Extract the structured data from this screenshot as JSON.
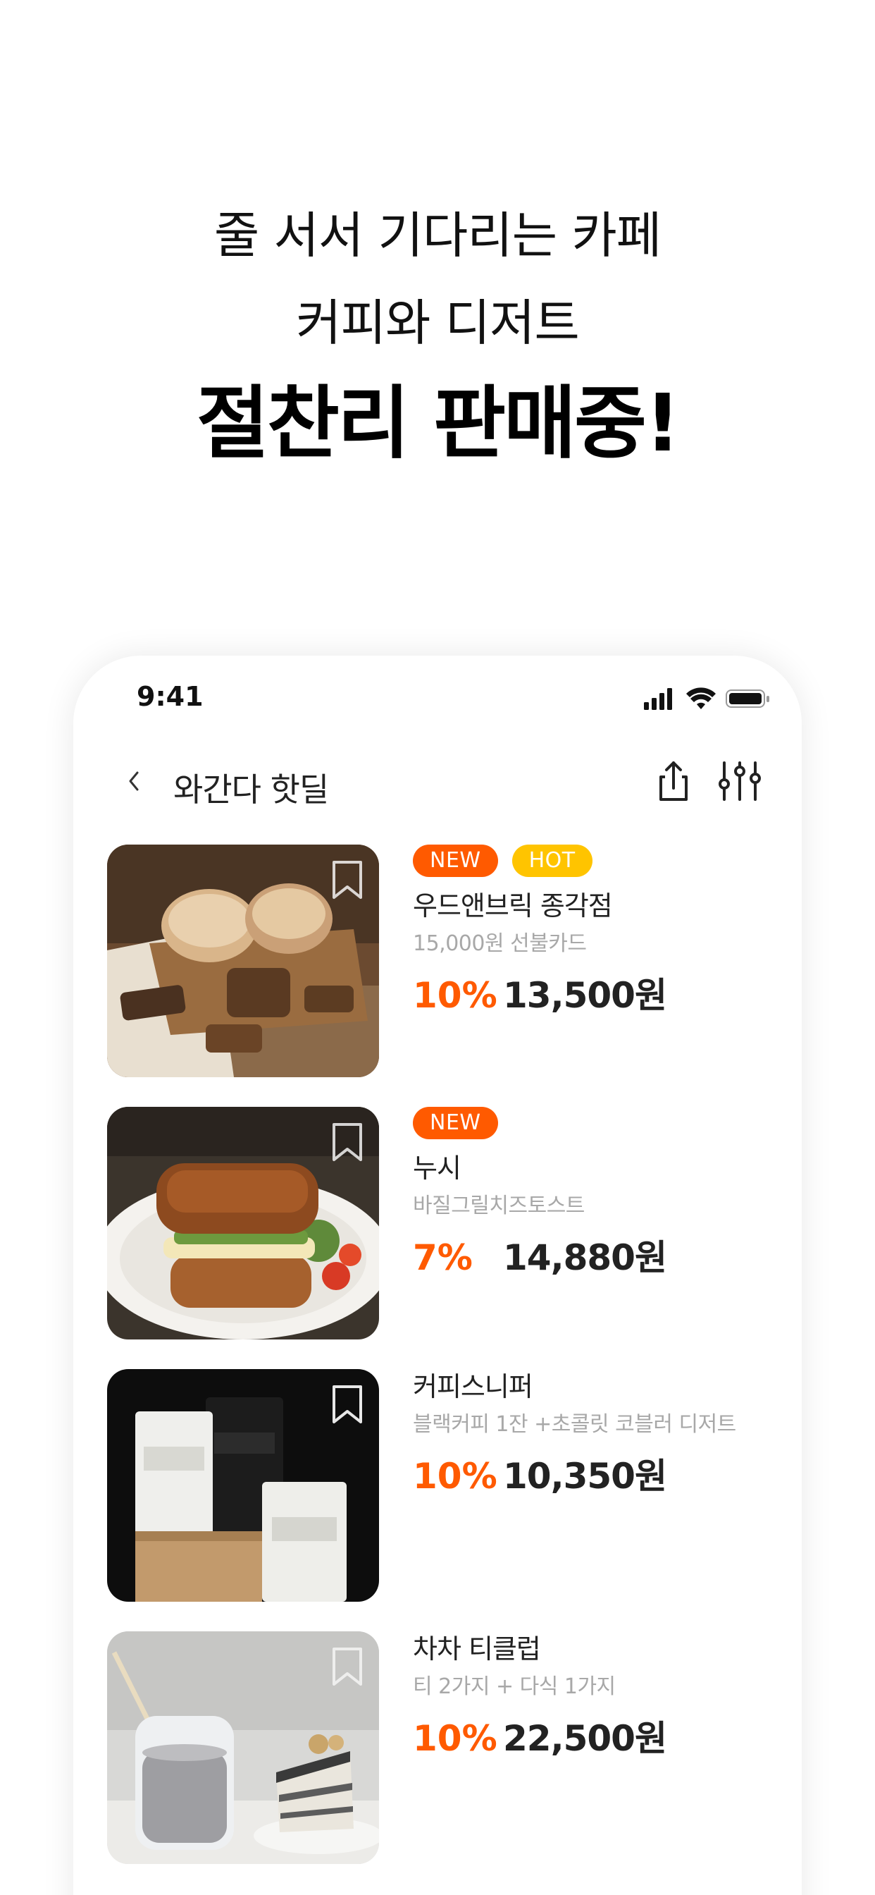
{
  "promo": {
    "line1": "줄 서서 기다리는 카페",
    "line2": "커피와 디저트",
    "line3": "절찬리 판매중!"
  },
  "status_bar": {
    "time": "9:41"
  },
  "nav": {
    "title": "와간다 핫딜"
  },
  "colors": {
    "accent": "#ff5a00",
    "hot_badge": "#ffc400"
  },
  "icons": [
    "back-chevron-icon",
    "share-icon",
    "filter-sliders-icon",
    "bookmark-icon",
    "signal-icon",
    "wifi-icon",
    "battery-icon"
  ],
  "items": [
    {
      "badges": [
        {
          "label": "NEW",
          "type": "new"
        },
        {
          "label": "HOT",
          "type": "hot"
        }
      ],
      "store": "우드앤브릭 종각점",
      "desc": "15,000원 선불카드",
      "discount": "10%",
      "price": "13,500원",
      "image": "bread"
    },
    {
      "badges": [
        {
          "label": "NEW",
          "type": "new"
        }
      ],
      "store": "누시",
      "desc": "바질그릴치즈토스트",
      "discount": "7%",
      "price": "14,880원",
      "image": "sandwich"
    },
    {
      "badges": [],
      "store": "커피스니퍼",
      "desc": "블랙커피 1잔 +초콜릿 코블러 디저트",
      "discount": "10%",
      "price": "10,350원",
      "image": "coffee-bags"
    },
    {
      "badges": [],
      "store": "차차 티클럽",
      "desc": "티 2가지 + 다식 1가지",
      "discount": "10%",
      "price": "22,500원",
      "image": "tea-cake"
    }
  ]
}
